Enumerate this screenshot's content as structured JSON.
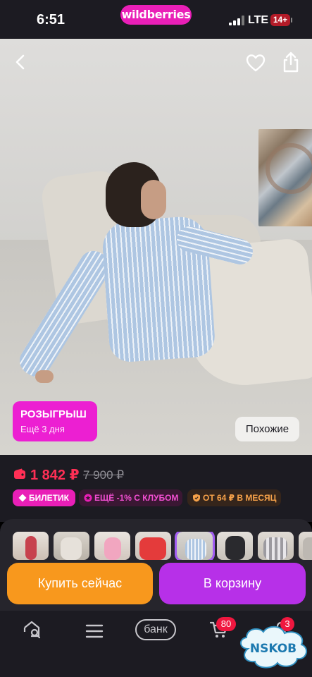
{
  "status_bar": {
    "time": "6:51",
    "network": "LTE",
    "battery": "14+"
  },
  "app": {
    "logo_text": "wildberries",
    "brand_color": "#e91fb7"
  },
  "product_photo": {
    "icons": [
      "back-icon",
      "heart-icon",
      "share-icon"
    ],
    "promo": {
      "title": "РОЗЫГРЫШ",
      "subtitle": "Ещё 3 дня"
    },
    "similar_label": "Похожие"
  },
  "pricing": {
    "price": "1 842 ₽",
    "old_price": "7 900 ₽",
    "price_color": "#ff2f55"
  },
  "chips": {
    "ticket": "БИЛЕТИК",
    "club": "ЕЩЁ -1% С КЛУБОМ",
    "installment": "ОТ 64 ₽ В МЕСЯЦ"
  },
  "color_variants": {
    "count_visible": 8,
    "selected_index": 4
  },
  "actions": {
    "buy_now": "Купить сейчас",
    "add_to_cart": "В корзину"
  },
  "tab_bar": {
    "items": [
      "home-search-icon",
      "catalog-icon",
      "bank",
      "cart-icon",
      "profile-icon"
    ],
    "bank_label": "банк",
    "cart_badge": "80",
    "profile_badge": "3"
  },
  "watermark": "NSKOB"
}
